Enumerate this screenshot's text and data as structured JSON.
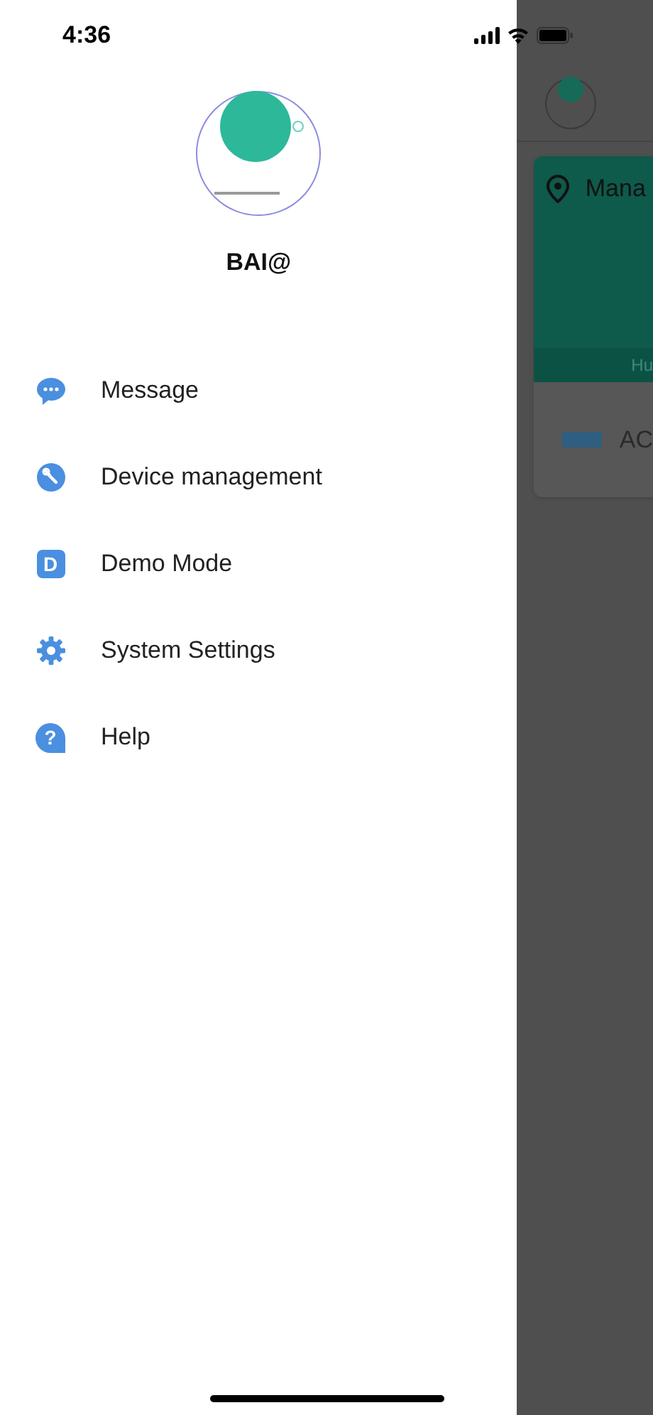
{
  "status_bar": {
    "time": "4:36"
  },
  "drawer": {
    "user_name": "BAI@",
    "menu": [
      {
        "kind": "message",
        "label": "Message"
      },
      {
        "kind": "device",
        "label": "Device management"
      },
      {
        "kind": "demo",
        "label": "Demo Mode",
        "icon_letter": "D"
      },
      {
        "kind": "settings",
        "label": "System Settings"
      },
      {
        "kind": "help",
        "label": "Help",
        "icon_char": "?"
      }
    ]
  },
  "background_page": {
    "card_title": "Mana",
    "card_footer": "Hu",
    "device_label": "AC"
  }
}
